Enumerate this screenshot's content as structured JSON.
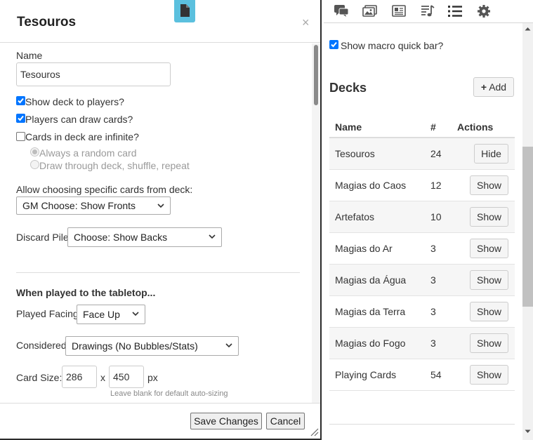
{
  "dialog": {
    "title": "Tesouros",
    "close_glyph": "×",
    "header_icon": "file-icon",
    "name_label": "Name",
    "name_value": "Tesouros",
    "options": [
      {
        "label": "Show deck to players?",
        "checked": true
      },
      {
        "label": "Players can draw cards?",
        "checked": true
      },
      {
        "label": "Cards in deck are infinite?",
        "checked": false
      }
    ],
    "infinite_modes": [
      {
        "label": "Always a random card",
        "selected": true
      },
      {
        "label": "Draw through deck, shuffle, repeat",
        "selected": false
      }
    ],
    "allow_choosing_label": "Allow choosing specific cards from deck:",
    "allow_choosing_value": "GM Choose: Show Fronts",
    "discard_label": "Discard Pile:",
    "discard_value": "Choose: Show Backs",
    "tabletop_heading": "When played to the tabletop...",
    "played_facing_label": "Played Facing:",
    "played_facing_value": "Face Up",
    "considered_label": "Considered:",
    "considered_value": "Drawings (No Bubbles/Stats)",
    "card_size_label": "Card Size:",
    "card_width": "286",
    "card_size_x": "x",
    "card_height": "450",
    "card_size_unit": "px",
    "card_size_hint": "Leave blank for default auto-sizing",
    "save_label": "Save Changes",
    "cancel_label": "Cancel"
  },
  "toolbar": {
    "icons": [
      "chat-icon",
      "image-icon",
      "journal-icon",
      "music-icon",
      "list-icon",
      "gear-icon"
    ],
    "active_icon": "list-icon"
  },
  "panel": {
    "macro_bar_label": "Show macro quick bar?",
    "macro_bar_checked": true,
    "decks_title": "Decks",
    "add_label": "Add",
    "add_glyph": "+",
    "table_headers": {
      "name": "Name",
      "count": "#",
      "actions": "Actions"
    },
    "decks": [
      {
        "name": "Tesouros",
        "count": "24",
        "action": "Hide"
      },
      {
        "name": "Magias do Caos",
        "count": "12",
        "action": "Show"
      },
      {
        "name": "Artefatos",
        "count": "10",
        "action": "Show"
      },
      {
        "name": "Magias do Ar",
        "count": "3",
        "action": "Show"
      },
      {
        "name": "Magias da Água",
        "count": "3",
        "action": "Show"
      },
      {
        "name": "Magias da Terra",
        "count": "3",
        "action": "Show"
      },
      {
        "name": "Magias do Fogo",
        "count": "3",
        "action": "Show"
      },
      {
        "name": "Playing Cards",
        "count": "54",
        "action": "Show"
      }
    ]
  },
  "colors": {
    "accent": "#5bc0de",
    "checkbox": "#0075ff",
    "toolbar_icon": "#555555"
  }
}
